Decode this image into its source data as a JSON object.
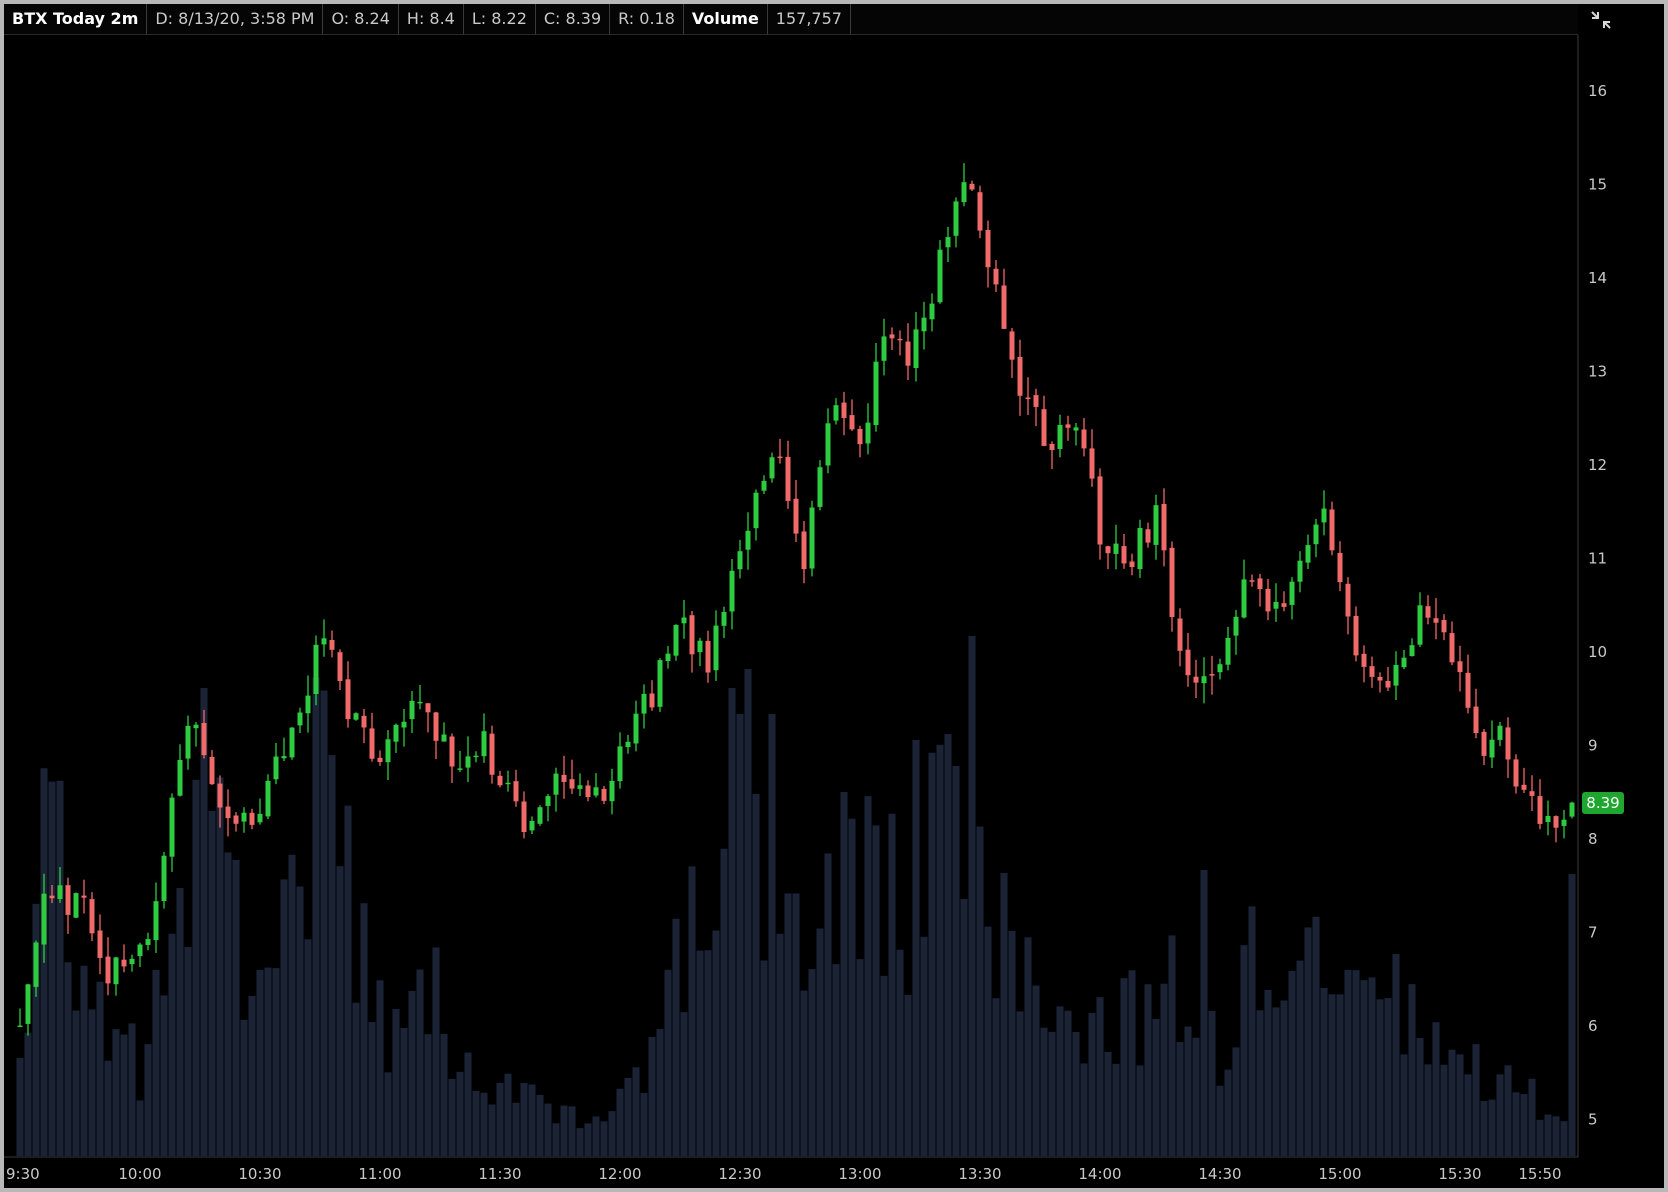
{
  "header": {
    "symbol": "BTX Today 2m",
    "date": "D: 8/13/20, 3:58 PM",
    "open": "O: 8.24",
    "high": "H: 8.4",
    "low": "L: 8.22",
    "close": "C: 8.39",
    "range": "R: 0.18",
    "volume_label": "Volume",
    "volume_value": "157,757"
  },
  "icons": {
    "corner": "collapse-arrows-icon"
  },
  "last_price": "8.39",
  "colors": {
    "up": "#2ecc40",
    "down": "#f06a6a",
    "volume": "#1b2436",
    "background": "#000000",
    "badge": "#1fa62e"
  },
  "chart_data": {
    "type": "candlestick",
    "title": "BTX Today 2m",
    "y_ticks": [
      "16",
      "15",
      "14",
      "13",
      "12",
      "11",
      "10",
      "9",
      "8",
      "7",
      "6",
      "5"
    ],
    "x_ticks": [
      "9:30",
      "10:00",
      "10:30",
      "11:00",
      "11:30",
      "12:00",
      "12:30",
      "13:00",
      "13:30",
      "14:00",
      "14:30",
      "15:00",
      "15:30",
      "15:50"
    ],
    "ylim": [
      4.6,
      16.6
    ],
    "interval_minutes": 2,
    "session": [
      "9:30",
      "15:58"
    ],
    "volume_series_name": "Volume",
    "volume_range": [
      0,
      160000
    ],
    "last_bar": {
      "time": "3:58 PM",
      "open": 8.24,
      "high": 8.4,
      "low": 8.22,
      "close": 8.39,
      "volume": 157757
    },
    "anchors": [
      {
        "t": "9:30",
        "p": 6.1
      },
      {
        "t": "9:36",
        "p": 7.3
      },
      {
        "t": "9:46",
        "p": 7.4
      },
      {
        "t": "9:52",
        "p": 6.6
      },
      {
        "t": "10:00",
        "p": 6.7
      },
      {
        "t": "10:06",
        "p": 7.8
      },
      {
        "t": "10:12",
        "p": 9.3
      },
      {
        "t": "10:16",
        "p": 8.9
      },
      {
        "t": "10:24",
        "p": 8.1
      },
      {
        "t": "10:30",
        "p": 8.4
      },
      {
        "t": "10:38",
        "p": 9.2
      },
      {
        "t": "10:46",
        "p": 10.2
      },
      {
        "t": "10:52",
        "p": 9.4
      },
      {
        "t": "11:00",
        "p": 8.9
      },
      {
        "t": "11:10",
        "p": 9.5
      },
      {
        "t": "11:20",
        "p": 8.8
      },
      {
        "t": "11:26",
        "p": 9.0
      },
      {
        "t": "11:36",
        "p": 8.25
      },
      {
        "t": "11:46",
        "p": 8.75
      },
      {
        "t": "11:54",
        "p": 8.4
      },
      {
        "t": "12:04",
        "p": 9.2
      },
      {
        "t": "12:16",
        "p": 10.3
      },
      {
        "t": "12:22",
        "p": 9.8
      },
      {
        "t": "12:30",
        "p": 11.2
      },
      {
        "t": "12:40",
        "p": 12.1
      },
      {
        "t": "12:46",
        "p": 10.9
      },
      {
        "t": "12:52",
        "p": 12.6
      },
      {
        "t": "13:00",
        "p": 12.2
      },
      {
        "t": "13:06",
        "p": 13.4
      },
      {
        "t": "13:12",
        "p": 13.1
      },
      {
        "t": "13:22",
        "p": 14.4
      },
      {
        "t": "13:26",
        "p": 15.1
      },
      {
        "t": "13:32",
        "p": 14.2
      },
      {
        "t": "13:38",
        "p": 13.0
      },
      {
        "t": "13:46",
        "p": 12.3
      },
      {
        "t": "13:56",
        "p": 12.3
      },
      {
        "t": "14:00",
        "p": 11.3
      },
      {
        "t": "14:08",
        "p": 11.0
      },
      {
        "t": "14:14",
        "p": 11.5
      },
      {
        "t": "14:20",
        "p": 10.0
      },
      {
        "t": "14:26",
        "p": 9.75
      },
      {
        "t": "14:30",
        "p": 9.8
      },
      {
        "t": "14:36",
        "p": 10.8
      },
      {
        "t": "14:44",
        "p": 10.4
      },
      {
        "t": "14:52",
        "p": 11.3
      },
      {
        "t": "14:56",
        "p": 11.5
      },
      {
        "t": "15:04",
        "p": 10.1
      },
      {
        "t": "15:10",
        "p": 9.6
      },
      {
        "t": "15:16",
        "p": 10.0
      },
      {
        "t": "15:20",
        "p": 10.4
      },
      {
        "t": "15:30",
        "p": 9.9
      },
      {
        "t": "15:36",
        "p": 8.9
      },
      {
        "t": "15:40",
        "p": 9.2
      },
      {
        "t": "15:46",
        "p": 8.5
      },
      {
        "t": "15:52",
        "p": 8.2
      },
      {
        "t": "15:58",
        "p": 8.39
      }
    ],
    "volume_profile": [
      {
        "t": "9:30",
        "v": 0.25
      },
      {
        "t": "9:38",
        "v": 0.7
      },
      {
        "t": "9:46",
        "v": 0.35
      },
      {
        "t": "9:52",
        "v": 0.25
      },
      {
        "t": "10:00",
        "v": 0.18
      },
      {
        "t": "10:10",
        "v": 0.55
      },
      {
        "t": "10:16",
        "v": 0.82
      },
      {
        "t": "10:22",
        "v": 0.5
      },
      {
        "t": "10:30",
        "v": 0.32
      },
      {
        "t": "10:36",
        "v": 0.55
      },
      {
        "t": "10:44",
        "v": 0.82
      },
      {
        "t": "10:50",
        "v": 0.6
      },
      {
        "t": "10:58",
        "v": 0.3
      },
      {
        "t": "11:06",
        "v": 0.22
      },
      {
        "t": "11:14",
        "v": 0.34
      },
      {
        "t": "11:24",
        "v": 0.15
      },
      {
        "t": "11:34",
        "v": 0.12
      },
      {
        "t": "11:46",
        "v": 0.08
      },
      {
        "t": "11:56",
        "v": 0.06
      },
      {
        "t": "12:06",
        "v": 0.2
      },
      {
        "t": "12:16",
        "v": 0.45
      },
      {
        "t": "12:24",
        "v": 0.55
      },
      {
        "t": "12:30",
        "v": 0.82
      },
      {
        "t": "12:38",
        "v": 0.55
      },
      {
        "t": "12:46",
        "v": 0.4
      },
      {
        "t": "12:54",
        "v": 0.5
      },
      {
        "t": "13:02",
        "v": 0.55
      },
      {
        "t": "13:10",
        "v": 0.5
      },
      {
        "t": "13:18",
        "v": 0.6
      },
      {
        "t": "13:24",
        "v": 0.85
      },
      {
        "t": "13:30",
        "v": 0.6
      },
      {
        "t": "13:38",
        "v": 0.4
      },
      {
        "t": "13:50",
        "v": 0.3
      },
      {
        "t": "14:00",
        "v": 0.28
      },
      {
        "t": "14:10",
        "v": 0.3
      },
      {
        "t": "14:20",
        "v": 0.35
      },
      {
        "t": "14:30",
        "v": 0.2
      },
      {
        "t": "14:38",
        "v": 0.38
      },
      {
        "t": "14:46",
        "v": 0.25
      },
      {
        "t": "14:52",
        "v": 0.38
      },
      {
        "t": "15:00",
        "v": 0.32
      },
      {
        "t": "15:10",
        "v": 0.3
      },
      {
        "t": "15:20",
        "v": 0.3
      },
      {
        "t": "15:30",
        "v": 0.18
      },
      {
        "t": "15:40",
        "v": 0.15
      },
      {
        "t": "15:50",
        "v": 0.12
      },
      {
        "t": "15:58",
        "v": 0.1
      }
    ],
    "volume_spikes": [
      {
        "t": "9:38",
        "v": 0.72
      },
      {
        "t": "10:16",
        "v": 0.9
      },
      {
        "t": "10:44",
        "v": 0.92
      },
      {
        "t": "12:30",
        "v": 0.85
      },
      {
        "t": "12:38",
        "v": 0.85
      },
      {
        "t": "12:56",
        "v": 0.7
      },
      {
        "t": "13:14",
        "v": 0.8
      },
      {
        "t": "13:24",
        "v": 0.75
      },
      {
        "t": "13:28",
        "v": 1.0
      },
      {
        "t": "14:26",
        "v": 0.55
      },
      {
        "t": "14:38",
        "v": 0.48
      },
      {
        "t": "14:54",
        "v": 0.46
      }
    ]
  }
}
